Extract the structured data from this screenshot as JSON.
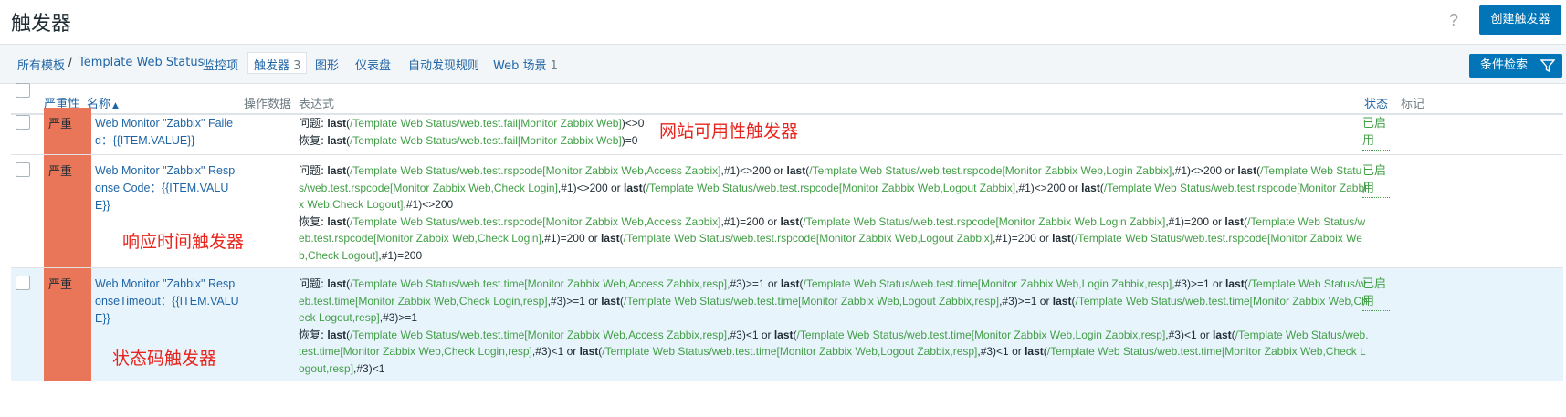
{
  "header": {
    "title": "触发器",
    "help_icon": "?",
    "create_button": "创建触发器"
  },
  "nav": {
    "all_templates": "所有模板",
    "separator": "/",
    "template": "Template Web Status",
    "items": "监控项",
    "triggers": "触发器",
    "triggers_count": "3",
    "graphs": "图形",
    "dashboards": "仪表盘",
    "discovery": "自动发现规则",
    "web": "Web 场景",
    "web_count": "1",
    "filter_button": "条件检索"
  },
  "table": {
    "columns": {
      "severity": "严重性",
      "name": "名称",
      "sort_indicator": "▲",
      "operational_data": "操作数据",
      "expression": "表达式",
      "status": "状态",
      "tags": "标记"
    },
    "rows": [
      {
        "severity": "严重",
        "name": "Web Monitor \"Zabbix\" Failed：{{ITEM.VALUE}}",
        "problem_label": "问题:",
        "recovery_label": "恢复:",
        "problem": [
          {
            "t": "last",
            "k": "fn"
          },
          {
            "t": "(",
            "k": "op"
          },
          {
            "t": "/Template Web Status/web.test.fail[Monitor Zabbix Web]",
            "k": "path"
          },
          {
            "t": ")<>0",
            "k": "op"
          }
        ],
        "recovery": [
          {
            "t": "last",
            "k": "fn"
          },
          {
            "t": "(",
            "k": "op"
          },
          {
            "t": "/Template Web Status/web.test.fail[Monitor Zabbix Web]",
            "k": "path"
          },
          {
            "t": ")=0",
            "k": "op"
          }
        ],
        "status": "已启用",
        "annotation": "网站可用性触发器"
      },
      {
        "severity": "严重",
        "name": "Web Monitor \"Zabbix\" Response Code：{{ITEM.VALUE}}",
        "problem_label": "问题:",
        "recovery_label": "恢复:",
        "problem": [
          {
            "t": "last",
            "k": "fn"
          },
          {
            "t": "(",
            "k": "op"
          },
          {
            "t": "/Template Web Status/web.test.rspcode[Monitor Zabbix Web,Access Zabbix]",
            "k": "path"
          },
          {
            "t": ",#1)<>200 or ",
            "k": "op"
          },
          {
            "t": "last",
            "k": "fn"
          },
          {
            "t": "(",
            "k": "op"
          },
          {
            "t": "/Template Web Status/web.test.rspcode[Monitor Zabbix Web,Login Zabbix]",
            "k": "path"
          },
          {
            "t": ",#1)<>200 or ",
            "k": "op"
          },
          {
            "t": "last",
            "k": "fn"
          },
          {
            "t": "(",
            "k": "op"
          },
          {
            "t": "/Template Web Status/web.test.rspcode[Monitor Zabbix Web,Check Login]",
            "k": "path"
          },
          {
            "t": ",#1)<>200 or ",
            "k": "op"
          },
          {
            "t": "last",
            "k": "fn"
          },
          {
            "t": "(",
            "k": "op"
          },
          {
            "t": "/Template Web Status/web.test.rspcode[Monitor Zabbix Web,Logout Zabbix]",
            "k": "path"
          },
          {
            "t": ",#1)<>200 or ",
            "k": "op"
          },
          {
            "t": "last",
            "k": "fn"
          },
          {
            "t": "(",
            "k": "op"
          },
          {
            "t": "/Template Web Status/web.test.rspcode[Monitor Zabbix Web,Check Logout]",
            "k": "path"
          },
          {
            "t": ",#1)<>200",
            "k": "op"
          }
        ],
        "recovery": [
          {
            "t": "last",
            "k": "fn"
          },
          {
            "t": "(",
            "k": "op"
          },
          {
            "t": "/Template Web Status/web.test.rspcode[Monitor Zabbix Web,Access Zabbix]",
            "k": "path"
          },
          {
            "t": ",#1)=200 or ",
            "k": "op"
          },
          {
            "t": "last",
            "k": "fn"
          },
          {
            "t": "(",
            "k": "op"
          },
          {
            "t": "/Template Web Status/web.test.rspcode[Monitor Zabbix Web,Login Zabbix]",
            "k": "path"
          },
          {
            "t": ",#1)=200 or ",
            "k": "op"
          },
          {
            "t": "last",
            "k": "fn"
          },
          {
            "t": "(",
            "k": "op"
          },
          {
            "t": "/Template Web Status/web.test.rspcode[Monitor Zabbix Web,Check Login]",
            "k": "path"
          },
          {
            "t": ",#1)=200 or ",
            "k": "op"
          },
          {
            "t": "last",
            "k": "fn"
          },
          {
            "t": "(",
            "k": "op"
          },
          {
            "t": "/Template Web Status/web.test.rspcode[Monitor Zabbix Web,Logout Zabbix]",
            "k": "path"
          },
          {
            "t": ",#1)=200 or ",
            "k": "op"
          },
          {
            "t": "last",
            "k": "fn"
          },
          {
            "t": "(",
            "k": "op"
          },
          {
            "t": "/Template Web Status/web.test.rspcode[Monitor Zabbix Web,Check Logout]",
            "k": "path"
          },
          {
            "t": ",#1)=200",
            "k": "op"
          }
        ],
        "status": "已启用",
        "annotation": "响应时间触发器"
      },
      {
        "severity": "严重",
        "name": "Web Monitor \"Zabbix\" ResponseTimeout：{{ITEM.VALUE}}",
        "problem_label": "问题:",
        "recovery_label": "恢复:",
        "problem": [
          {
            "t": "last",
            "k": "fn"
          },
          {
            "t": "(",
            "k": "op"
          },
          {
            "t": "/Template Web Status/web.test.time[Monitor Zabbix Web,Access Zabbix,resp]",
            "k": "path"
          },
          {
            "t": ",#3)>=1 or ",
            "k": "op"
          },
          {
            "t": "last",
            "k": "fn"
          },
          {
            "t": "(",
            "k": "op"
          },
          {
            "t": "/Template Web Status/web.test.time[Monitor Zabbix Web,Login Zabbix,resp]",
            "k": "path"
          },
          {
            "t": ",#3)>=1 or ",
            "k": "op"
          },
          {
            "t": "last",
            "k": "fn"
          },
          {
            "t": "(",
            "k": "op"
          },
          {
            "t": "/Template Web Status/web.test.time[Monitor Zabbix Web,Check Login,resp]",
            "k": "path"
          },
          {
            "t": ",#3)>=1 or ",
            "k": "op"
          },
          {
            "t": "last",
            "k": "fn"
          },
          {
            "t": "(",
            "k": "op"
          },
          {
            "t": "/Template Web Status/web.test.time[Monitor Zabbix Web,Logout Zabbix,resp]",
            "k": "path"
          },
          {
            "t": ",#3)>=1 or ",
            "k": "op"
          },
          {
            "t": "last",
            "k": "fn"
          },
          {
            "t": "(",
            "k": "op"
          },
          {
            "t": "/Template Web Status/web.test.time[Monitor Zabbix Web,Check Logout,resp]",
            "k": "path"
          },
          {
            "t": ",#3)>=1",
            "k": "op"
          }
        ],
        "recovery": [
          {
            "t": "last",
            "k": "fn"
          },
          {
            "t": "(",
            "k": "op"
          },
          {
            "t": "/Template Web Status/web.test.time[Monitor Zabbix Web,Access Zabbix,resp]",
            "k": "path"
          },
          {
            "t": ",#3)<1 or ",
            "k": "op"
          },
          {
            "t": "last",
            "k": "fn"
          },
          {
            "t": "(",
            "k": "op"
          },
          {
            "t": "/Template Web Status/web.test.time[Monitor Zabbix Web,Login Zabbix,resp]",
            "k": "path"
          },
          {
            "t": ",#3)<1 or ",
            "k": "op"
          },
          {
            "t": "last",
            "k": "fn"
          },
          {
            "t": "(",
            "k": "op"
          },
          {
            "t": "/Template Web Status/web.test.time[Monitor Zabbix Web,Check Login,resp]",
            "k": "path"
          },
          {
            "t": ",#3)<1 or ",
            "k": "op"
          },
          {
            "t": "last",
            "k": "fn"
          },
          {
            "t": "(",
            "k": "op"
          },
          {
            "t": "/Template Web Status/web.test.time[Monitor Zabbix Web,Logout Zabbix,resp]",
            "k": "path"
          },
          {
            "t": ",#3)<1 or ",
            "k": "op"
          },
          {
            "t": "last",
            "k": "fn"
          },
          {
            "t": "(",
            "k": "op"
          },
          {
            "t": "/Template Web Status/web.test.time[Monitor Zabbix Web,Check Logout,resp]",
            "k": "path"
          },
          {
            "t": ",#3)<1",
            "k": "op"
          }
        ],
        "status": "已启用",
        "annotation": "状态码触发器"
      }
    ]
  },
  "colors": {
    "accent": "#0275b8",
    "severity_high": "#e97659",
    "link": "#1f65a6",
    "path": "#429e47",
    "annotation": "#e8241c",
    "row_highlight": "#e8f4fc"
  }
}
